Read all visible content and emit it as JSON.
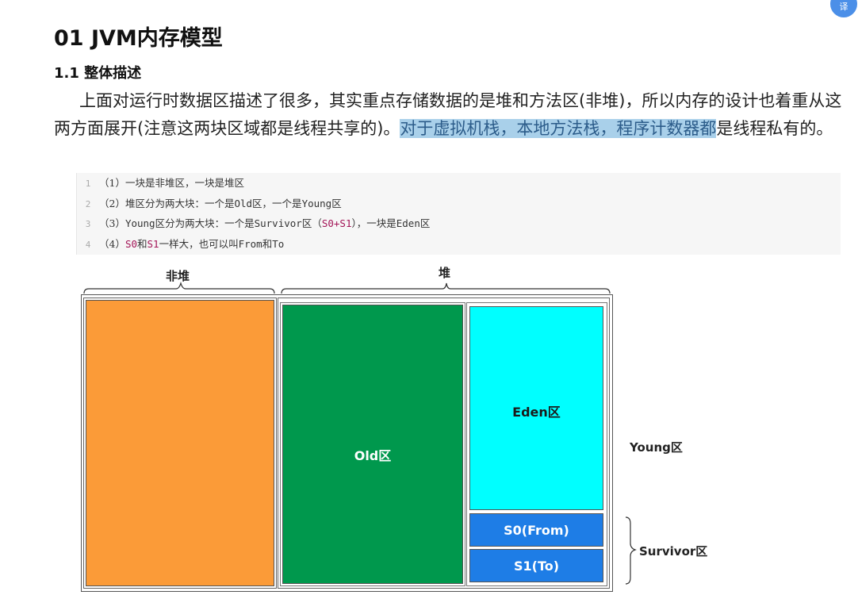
{
  "corner_icon": "translate-icon",
  "corner_text": "译",
  "heading1": "01 JVM内存模型",
  "heading2": "1.1 整体描述",
  "paragraph": {
    "part1": "上面对运行时数据区描述了很多，其实重点存储数据的是堆和方法区(非堆)，所以内存的设计也着重从这两方面展开(注意这两块区域都是线程共享的)。",
    "highlight": "对于虚拟机栈，本地方法栈，程序计数器都",
    "part2": "是线程私有的。"
  },
  "code": {
    "lines": [
      {
        "num": "1",
        "a": "（1）一块是非堆区，一块是堆区"
      },
      {
        "num": "2",
        "a": "（2）堆区分为两大块：一个是",
        "b": "Old",
        "c": "区，一个是",
        "d": "Young",
        "e": "区"
      },
      {
        "num": "3",
        "a": "（3）",
        "b": "Young",
        "c": "区分为两大块：一个是",
        "d": "Survivor",
        "e": "区（",
        "f": "S0+S1",
        "g": "），一块是",
        "h": "Eden",
        "i": "区"
      },
      {
        "num": "4",
        "a": "（4）",
        "b": "S0",
        "c": "和",
        "d": "S1",
        "e": "一样大，也可以叫",
        "f": "From",
        "g": "和",
        "h": "To"
      }
    ]
  },
  "diagram": {
    "nonheap_label": "非堆",
    "heap_label": "堆",
    "old_label": "Old区",
    "eden_label": "Eden区",
    "s0_label": "S0(From)",
    "s1_label": "S1(To)",
    "young_label": "Young区",
    "survivor_label": "Survivor区",
    "colors": {
      "nonheap": "#fb9b38",
      "old": "#00984d",
      "eden": "#00ffff",
      "survivor": "#1e7de6"
    }
  }
}
